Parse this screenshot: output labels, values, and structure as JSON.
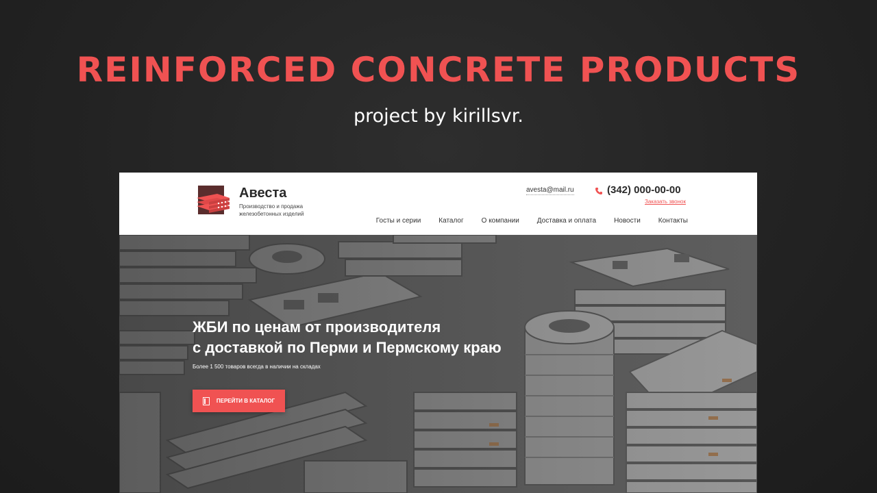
{
  "promo": {
    "title": "REINFORCED CONCRETE PRODUCTS",
    "subtitle": "project by kirillsvr."
  },
  "site": {
    "logo": {
      "name": "Авеста",
      "tagline": "Производство и продажа железобетонных изделий"
    },
    "contact": {
      "email": "avesta@mail.ru",
      "phone": "(342) 000-00-00",
      "callback": "Заказать звонок"
    },
    "nav": [
      "Госты и серии",
      "Каталог",
      "О компании",
      "Доставка и оплата",
      "Новости",
      "Контакты"
    ],
    "hero": {
      "title_line1": "ЖБИ по ценам от производителя",
      "title_line2": "с доставкой по Перми и Пермскому краю",
      "note": "Более 1 500 товаров всегда в наличии на складах",
      "cta": "ПЕРЕЙТИ В КАТАЛОГ"
    }
  },
  "colors": {
    "accent": "#f05252",
    "background": "#232323",
    "header_bg": "#ffffff"
  }
}
